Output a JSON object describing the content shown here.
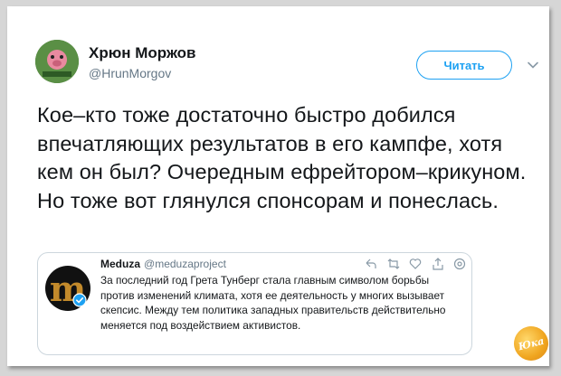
{
  "tweet": {
    "author_name": "Хрюн Моржов",
    "author_handle": "@HrunMorgov",
    "follow_label": "Читать",
    "text": "Кое–кто тоже достаточно быстро добился впечатляющих результатов в его кампфе, хотя кем он был? Очередным ефрейтором–крикуном. Но тоже вот глянулся спонсорам и понеслась."
  },
  "quoted_tweet": {
    "author_name": "Meduza",
    "author_handle": "@meduzaproject",
    "avatar_letter": "m",
    "text": "За последний год Грета Тунберг стала главным символом борьбы против изменений климата, хотя ее деятельность у многих вызывает скепсис. Между тем политика западных правительств действительно меняется под воздействием активистов.",
    "actions": [
      "reply-icon",
      "retweet-icon",
      "like-icon",
      "share-icon",
      "settings-icon"
    ]
  },
  "watermark": {
    "text": "Юка"
  },
  "colors": {
    "accent": "#1da1f2",
    "text": "#14171a",
    "secondary": "#657786",
    "border": "#ccd6dd"
  }
}
